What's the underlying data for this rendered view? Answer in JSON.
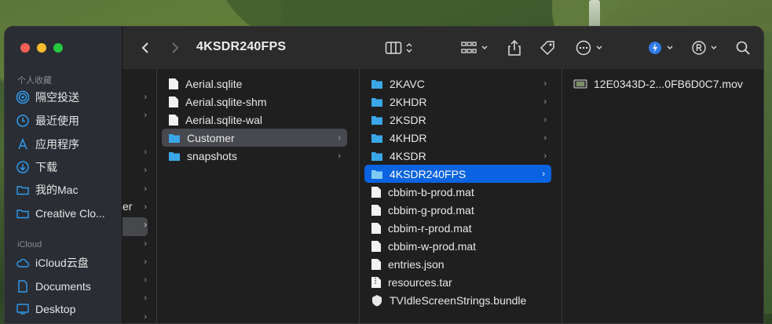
{
  "window": {
    "title": "4KSDR240FPS"
  },
  "sidebar": {
    "favorites_header": "个人收藏",
    "favorites": [
      {
        "label": "隔空投送",
        "icon": "airdrop-icon"
      },
      {
        "label": "最近使用",
        "icon": "clock-icon"
      },
      {
        "label": "应用程序",
        "icon": "applications-icon"
      },
      {
        "label": "下载",
        "icon": "download-icon"
      },
      {
        "label": "我的Mac",
        "icon": "folder-icon"
      },
      {
        "label": "Creative Clo...",
        "icon": "folder-icon"
      }
    ],
    "icloud_header": "iCloud",
    "icloud": [
      {
        "label": "iCloud云盘",
        "icon": "cloud-icon"
      },
      {
        "label": "Documents",
        "icon": "document-icon"
      },
      {
        "label": "Desktop",
        "icon": "desktop-icon"
      }
    ]
  },
  "column0": {
    "fragment": "er"
  },
  "column1": {
    "items": [
      {
        "name": "Aerial.sqlite",
        "type": "file"
      },
      {
        "name": "Aerial.sqlite-shm",
        "type": "file"
      },
      {
        "name": "Aerial.sqlite-wal",
        "type": "file"
      },
      {
        "name": "Customer",
        "type": "folder",
        "selected": true
      },
      {
        "name": "snapshots",
        "type": "folder"
      }
    ]
  },
  "column2": {
    "items": [
      {
        "name": "2KAVC",
        "type": "folder"
      },
      {
        "name": "2KHDR",
        "type": "folder"
      },
      {
        "name": "2KSDR",
        "type": "folder"
      },
      {
        "name": "4KHDR",
        "type": "folder"
      },
      {
        "name": "4KSDR",
        "type": "folder"
      },
      {
        "name": "4KSDR240FPS",
        "type": "folder",
        "selected": true
      },
      {
        "name": "cbbim-b-prod.mat",
        "type": "file"
      },
      {
        "name": "cbbim-g-prod.mat",
        "type": "file"
      },
      {
        "name": "cbbim-r-prod.mat",
        "type": "file"
      },
      {
        "name": "cbbim-w-prod.mat",
        "type": "file"
      },
      {
        "name": "entries.json",
        "type": "file"
      },
      {
        "name": "resources.tar",
        "type": "file"
      },
      {
        "name": "TVIdleScreenStrings.bundle",
        "type": "bundle"
      }
    ]
  },
  "column3": {
    "items": [
      {
        "name": "12E0343D-2...0FB6D0C7.mov",
        "type": "movie"
      }
    ]
  },
  "toolbar": {
    "icons": [
      "back-icon",
      "forward-icon",
      "column-view-icon",
      "group-icon",
      "share-icon",
      "tag-icon",
      "more-icon",
      "app-extension-icon",
      "registered-icon",
      "search-icon"
    ]
  },
  "colors": {
    "selection_blue": "#0a63e0",
    "folder_blue": "#3aa7e8"
  }
}
